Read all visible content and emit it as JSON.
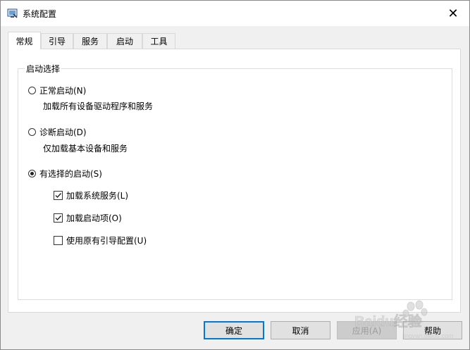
{
  "window": {
    "title": "系统配置",
    "close_glyph": "✕"
  },
  "tabs": [
    {
      "label": "常规",
      "active": true
    },
    {
      "label": "引导",
      "active": false
    },
    {
      "label": "服务",
      "active": false
    },
    {
      "label": "启动",
      "active": false
    },
    {
      "label": "工具",
      "active": false
    }
  ],
  "startup_group": {
    "legend": "启动选择",
    "normal": {
      "label": "正常启动(N)",
      "desc": "加载所有设备驱动程序和服务",
      "selected": false
    },
    "diagnostic": {
      "label": "诊断启动(D)",
      "desc": "仅加载基本设备和服务",
      "selected": false
    },
    "selective": {
      "label": "有选择的启动(S)",
      "selected": true,
      "load_services": {
        "label": "加载系统服务(L)",
        "checked": true
      },
      "load_startup": {
        "label": "加载启动项(O)",
        "checked": true
      },
      "use_original_boot": {
        "label": "使用原有引导配置(U)",
        "checked": false
      }
    }
  },
  "buttons": {
    "ok": "确定",
    "cancel": "取消",
    "apply": "应用(A)",
    "help": "帮助"
  },
  "watermark": {
    "text": "Baidu经验",
    "subtext": "jingyan.baidu.com"
  },
  "colors": {
    "accent": "#0078d7",
    "panel": "#ffffff",
    "chrome": "#f0f0f0"
  }
}
